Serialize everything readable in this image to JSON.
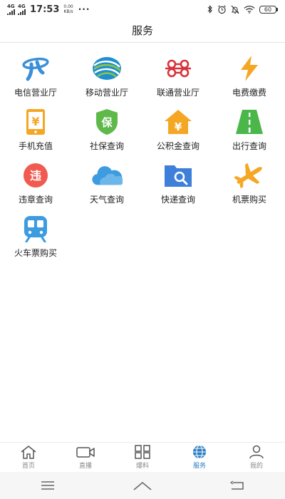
{
  "status_bar": {
    "network_top": "4G",
    "network_top2": "4G",
    "time": "17:53",
    "speed_value": "0.00",
    "speed_unit": "KB/s",
    "more": "···",
    "battery": "60"
  },
  "header": {
    "title": "服务"
  },
  "services": [
    {
      "label": "电信营业厅",
      "icon": "telecom-logo-icon",
      "color": "#3b8fd9"
    },
    {
      "label": "移动营业厅",
      "icon": "mobile-logo-icon",
      "color": "#1f8fd0"
    },
    {
      "label": "联通营业厅",
      "icon": "unicom-logo-icon",
      "color": "#d9323a"
    },
    {
      "label": "电费缴费",
      "icon": "lightning-icon",
      "color": "#f5a623"
    },
    {
      "label": "手机充值",
      "icon": "phone-recharge-icon",
      "color": "#f5a623",
      "glyph": "¥"
    },
    {
      "label": "社保查询",
      "icon": "social-security-shield-icon",
      "color": "#5fb84a",
      "glyph": "保"
    },
    {
      "label": "公积金查询",
      "icon": "housing-fund-icon",
      "color": "#f5a623",
      "glyph": "¥"
    },
    {
      "label": "出行查询",
      "icon": "road-icon",
      "color": "#4bb64a"
    },
    {
      "label": "违章查询",
      "icon": "violation-icon",
      "color": "#f05a50",
      "glyph": "违"
    },
    {
      "label": "天气查询",
      "icon": "weather-cloud-icon",
      "color": "#3d9be0"
    },
    {
      "label": "快递查询",
      "icon": "express-search-icon",
      "color": "#3d7fd9"
    },
    {
      "label": "机票购买",
      "icon": "airplane-icon",
      "color": "#f5a623"
    },
    {
      "label": "火车票购买",
      "icon": "train-icon",
      "color": "#3d9be0"
    }
  ],
  "tabs": [
    {
      "label": "首页",
      "icon": "home-icon",
      "active": false
    },
    {
      "label": "直播",
      "icon": "video-camera-icon",
      "active": false
    },
    {
      "label": "爆料",
      "icon": "grid-icon",
      "active": false
    },
    {
      "label": "服务",
      "icon": "globe-icon",
      "active": true
    },
    {
      "label": "我的",
      "icon": "user-icon",
      "active": false
    }
  ],
  "colors": {
    "accent": "#2c7ec4",
    "tab_inactive": "#888888"
  }
}
